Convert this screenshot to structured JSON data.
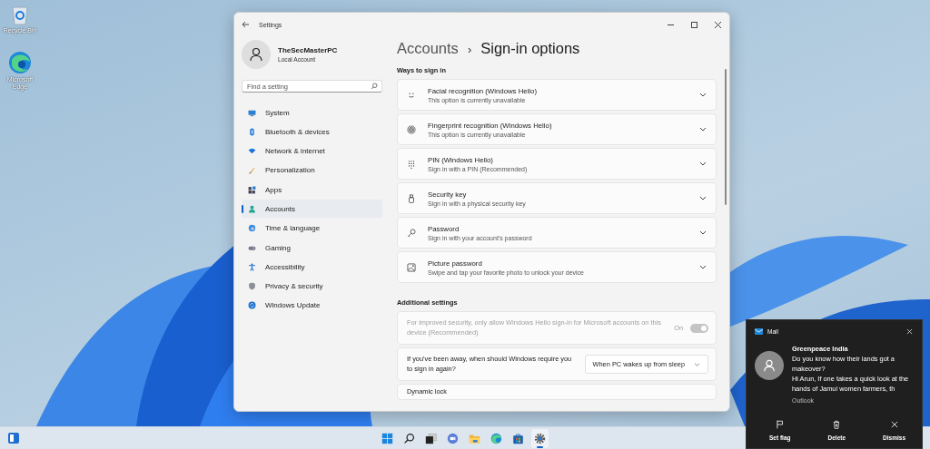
{
  "desktop_icons": [
    {
      "label": "Recycle Bin"
    },
    {
      "label": "Microsoft Edge"
    }
  ],
  "settings_window": {
    "title": "Settings",
    "account": {
      "name": "TheSecMasterPC",
      "type": "Local Account"
    },
    "search": {
      "placeholder": "Find a setting"
    },
    "nav_items": [
      {
        "label": "System",
        "selected": false
      },
      {
        "label": "Bluetooth & devices",
        "selected": false
      },
      {
        "label": "Network & internet",
        "selected": false
      },
      {
        "label": "Personalization",
        "selected": false
      },
      {
        "label": "Apps",
        "selected": false
      },
      {
        "label": "Accounts",
        "selected": true
      },
      {
        "label": "Time & language",
        "selected": false
      },
      {
        "label": "Gaming",
        "selected": false
      },
      {
        "label": "Accessibility",
        "selected": false
      },
      {
        "label": "Privacy & security",
        "selected": false
      },
      {
        "label": "Windows Update",
        "selected": false
      }
    ],
    "breadcrumb": {
      "parent": "Accounts",
      "separator": "›",
      "current": "Sign-in options"
    },
    "ways_heading": "Ways to sign in",
    "sign_in_options": [
      {
        "title": "Facial recognition (Windows Hello)",
        "subtitle": "This option is currently unavailable"
      },
      {
        "title": "Fingerprint recognition (Windows Hello)",
        "subtitle": "This option is currently unavailable"
      },
      {
        "title": "PIN (Windows Hello)",
        "subtitle": "Sign in with a PIN (Recommended)"
      },
      {
        "title": "Security key",
        "subtitle": "Sign in with a physical security key"
      },
      {
        "title": "Password",
        "subtitle": "Sign in with your account's password"
      },
      {
        "title": "Picture password",
        "subtitle": "Swipe and tap your favorite photo to unlock your device"
      }
    ],
    "additional_heading": "Additional settings",
    "additional_settings": [
      {
        "kind": "toggle",
        "label": "For improved security, only allow Windows Hello sign-in for Microsoft accounts on this device (Recommended)",
        "disabled": true,
        "state_label": "On",
        "on": true
      },
      {
        "kind": "dropdown",
        "label": "If you've been away, when should Windows require you to sign in again?",
        "value": "When PC wakes up from sleep"
      },
      {
        "kind": "plain",
        "label": "Dynamic lock"
      }
    ]
  },
  "notification": {
    "app": "Mail",
    "sender": "Greenpeace India",
    "subject": "Do you know how their lands got a makeover?",
    "preview": "Hi Arun, If one takes a quick look at the hands of Jamui women farmers, th",
    "source": "Outlook",
    "actions": [
      {
        "label": "Set flag"
      },
      {
        "label": "Delete"
      },
      {
        "label": "Dismiss"
      }
    ]
  },
  "taskbar": {
    "apps": [
      {
        "active": false
      },
      {
        "active": false
      },
      {
        "active": false
      },
      {
        "active": false
      },
      {
        "active": false
      },
      {
        "active": false
      },
      {
        "active": false
      },
      {
        "active": true
      }
    ]
  }
}
